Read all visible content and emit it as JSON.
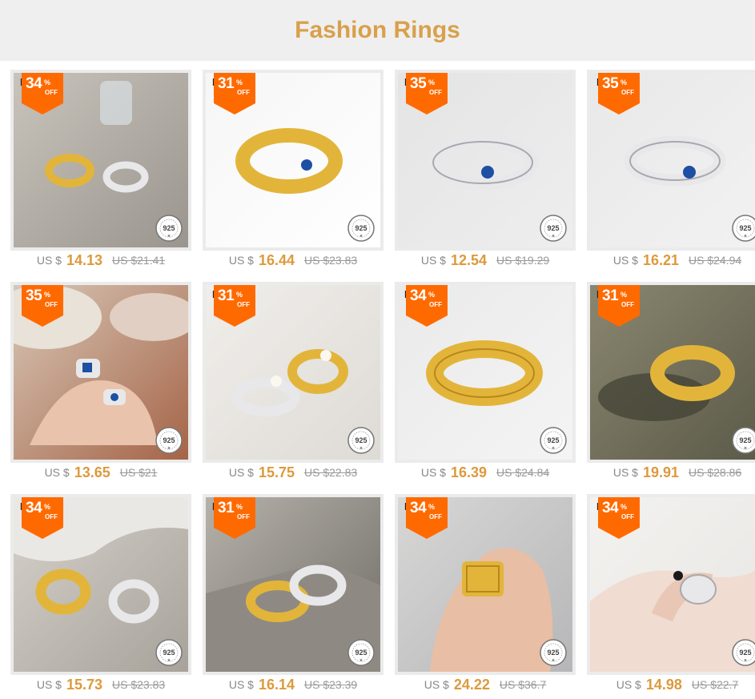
{
  "header": {
    "title": "Fashion Rings"
  },
  "currency": "US $",
  "products": [
    {
      "discount": "34",
      "price": "14.13",
      "old_price": "US $21.41",
      "brand": "LOUR",
      "bg": "#9a958e",
      "bg2": "#c8c3bb",
      "scene": "two-rings-gold-silver",
      "stamp": "925"
    },
    {
      "discount": "31",
      "price": "16.44",
      "old_price": "US $23.83",
      "brand": "LOUR",
      "bg": "#ffffff",
      "bg2": "#f6f6f6",
      "scene": "gold-ring-blue-stone",
      "stamp": "925"
    },
    {
      "discount": "35",
      "price": "12.54",
      "old_price": "US $19.29",
      "brand": "LOUR",
      "bg": "#eeeeee",
      "bg2": "#e4e4e4",
      "scene": "silver-ring-blue-stone",
      "stamp": "925"
    },
    {
      "discount": "35",
      "price": "16.21",
      "old_price": "US $24.94",
      "brand": "LOUR",
      "bg": "#f2f2f2",
      "bg2": "#e8e8e8",
      "scene": "silver-ring-blue-stone-2",
      "stamp": "925"
    },
    {
      "discount": "35",
      "price": "13.65",
      "old_price": "US $21",
      "brand": "",
      "bg": "#a56447",
      "bg2": "#d7c7b7",
      "scene": "hand-with-rings",
      "stamp": "925"
    },
    {
      "discount": "31",
      "price": "15.75",
      "old_price": "US $22.83",
      "brand": "LOUR",
      "bg": "#dedbd6",
      "bg2": "#f0eeea",
      "scene": "pearl-rings",
      "stamp": "925"
    },
    {
      "discount": "34",
      "price": "16.39",
      "old_price": "US $24.84",
      "brand": "LOUR",
      "bg": "#f4f4f4",
      "bg2": "#eaeaea",
      "scene": "gold-wide-ring",
      "stamp": "925"
    },
    {
      "discount": "31",
      "price": "19.91",
      "old_price": "US $28.86",
      "brand": "LOUR",
      "bg": "#5b5a48",
      "bg2": "#8a8670",
      "scene": "gold-ring-shadow",
      "stamp": "925"
    },
    {
      "discount": "34",
      "price": "15.73",
      "old_price": "US $23.83",
      "brand": "LOUR",
      "bg": "#a7a29a",
      "bg2": "#d6d2cb",
      "scene": "two-rings-stone",
      "stamp": "925"
    },
    {
      "discount": "31",
      "price": "16.14",
      "old_price": "US $23.39",
      "brand": "LOUR",
      "bg": "#6f6c66",
      "bg2": "#b6b2aa",
      "scene": "rings-on-stone-block",
      "stamp": "925"
    },
    {
      "discount": "34",
      "price": "24.22",
      "old_price": "US $36.7",
      "brand": "LOUR",
      "bg": "#b6b6b8",
      "bg2": "#d8d7d6",
      "scene": "finger-gold-ring",
      "stamp": "925"
    },
    {
      "discount": "34",
      "price": "14.98",
      "old_price": "US $22.7",
      "brand": "LOUR",
      "bg": "#e7e6e3",
      "bg2": "#f3f2ef",
      "scene": "hand-silver-ring",
      "stamp": "925"
    }
  ],
  "badge": {
    "symbol": "%",
    "off": "OFF",
    "color": "#ff6a00"
  },
  "colors": {
    "title": "#d9a04b",
    "price": "#dc9a3c",
    "header_bg": "#efefef"
  }
}
